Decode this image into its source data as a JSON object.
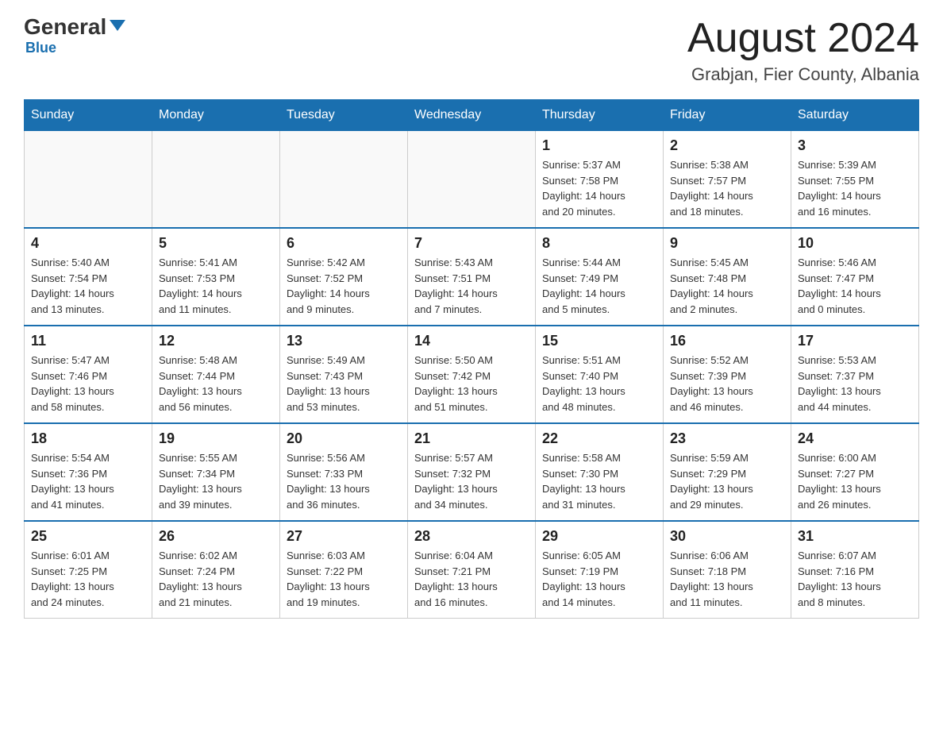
{
  "header": {
    "logo_general": "General",
    "logo_blue": "Blue",
    "main_title": "August 2024",
    "subtitle": "Grabjan, Fier County, Albania"
  },
  "days_of_week": [
    "Sunday",
    "Monday",
    "Tuesday",
    "Wednesday",
    "Thursday",
    "Friday",
    "Saturday"
  ],
  "weeks": [
    {
      "days": [
        {
          "num": "",
          "info": ""
        },
        {
          "num": "",
          "info": ""
        },
        {
          "num": "",
          "info": ""
        },
        {
          "num": "",
          "info": ""
        },
        {
          "num": "1",
          "info": "Sunrise: 5:37 AM\nSunset: 7:58 PM\nDaylight: 14 hours\nand 20 minutes."
        },
        {
          "num": "2",
          "info": "Sunrise: 5:38 AM\nSunset: 7:57 PM\nDaylight: 14 hours\nand 18 minutes."
        },
        {
          "num": "3",
          "info": "Sunrise: 5:39 AM\nSunset: 7:55 PM\nDaylight: 14 hours\nand 16 minutes."
        }
      ]
    },
    {
      "days": [
        {
          "num": "4",
          "info": "Sunrise: 5:40 AM\nSunset: 7:54 PM\nDaylight: 14 hours\nand 13 minutes."
        },
        {
          "num": "5",
          "info": "Sunrise: 5:41 AM\nSunset: 7:53 PM\nDaylight: 14 hours\nand 11 minutes."
        },
        {
          "num": "6",
          "info": "Sunrise: 5:42 AM\nSunset: 7:52 PM\nDaylight: 14 hours\nand 9 minutes."
        },
        {
          "num": "7",
          "info": "Sunrise: 5:43 AM\nSunset: 7:51 PM\nDaylight: 14 hours\nand 7 minutes."
        },
        {
          "num": "8",
          "info": "Sunrise: 5:44 AM\nSunset: 7:49 PM\nDaylight: 14 hours\nand 5 minutes."
        },
        {
          "num": "9",
          "info": "Sunrise: 5:45 AM\nSunset: 7:48 PM\nDaylight: 14 hours\nand 2 minutes."
        },
        {
          "num": "10",
          "info": "Sunrise: 5:46 AM\nSunset: 7:47 PM\nDaylight: 14 hours\nand 0 minutes."
        }
      ]
    },
    {
      "days": [
        {
          "num": "11",
          "info": "Sunrise: 5:47 AM\nSunset: 7:46 PM\nDaylight: 13 hours\nand 58 minutes."
        },
        {
          "num": "12",
          "info": "Sunrise: 5:48 AM\nSunset: 7:44 PM\nDaylight: 13 hours\nand 56 minutes."
        },
        {
          "num": "13",
          "info": "Sunrise: 5:49 AM\nSunset: 7:43 PM\nDaylight: 13 hours\nand 53 minutes."
        },
        {
          "num": "14",
          "info": "Sunrise: 5:50 AM\nSunset: 7:42 PM\nDaylight: 13 hours\nand 51 minutes."
        },
        {
          "num": "15",
          "info": "Sunrise: 5:51 AM\nSunset: 7:40 PM\nDaylight: 13 hours\nand 48 minutes."
        },
        {
          "num": "16",
          "info": "Sunrise: 5:52 AM\nSunset: 7:39 PM\nDaylight: 13 hours\nand 46 minutes."
        },
        {
          "num": "17",
          "info": "Sunrise: 5:53 AM\nSunset: 7:37 PM\nDaylight: 13 hours\nand 44 minutes."
        }
      ]
    },
    {
      "days": [
        {
          "num": "18",
          "info": "Sunrise: 5:54 AM\nSunset: 7:36 PM\nDaylight: 13 hours\nand 41 minutes."
        },
        {
          "num": "19",
          "info": "Sunrise: 5:55 AM\nSunset: 7:34 PM\nDaylight: 13 hours\nand 39 minutes."
        },
        {
          "num": "20",
          "info": "Sunrise: 5:56 AM\nSunset: 7:33 PM\nDaylight: 13 hours\nand 36 minutes."
        },
        {
          "num": "21",
          "info": "Sunrise: 5:57 AM\nSunset: 7:32 PM\nDaylight: 13 hours\nand 34 minutes."
        },
        {
          "num": "22",
          "info": "Sunrise: 5:58 AM\nSunset: 7:30 PM\nDaylight: 13 hours\nand 31 minutes."
        },
        {
          "num": "23",
          "info": "Sunrise: 5:59 AM\nSunset: 7:29 PM\nDaylight: 13 hours\nand 29 minutes."
        },
        {
          "num": "24",
          "info": "Sunrise: 6:00 AM\nSunset: 7:27 PM\nDaylight: 13 hours\nand 26 minutes."
        }
      ]
    },
    {
      "days": [
        {
          "num": "25",
          "info": "Sunrise: 6:01 AM\nSunset: 7:25 PM\nDaylight: 13 hours\nand 24 minutes."
        },
        {
          "num": "26",
          "info": "Sunrise: 6:02 AM\nSunset: 7:24 PM\nDaylight: 13 hours\nand 21 minutes."
        },
        {
          "num": "27",
          "info": "Sunrise: 6:03 AM\nSunset: 7:22 PM\nDaylight: 13 hours\nand 19 minutes."
        },
        {
          "num": "28",
          "info": "Sunrise: 6:04 AM\nSunset: 7:21 PM\nDaylight: 13 hours\nand 16 minutes."
        },
        {
          "num": "29",
          "info": "Sunrise: 6:05 AM\nSunset: 7:19 PM\nDaylight: 13 hours\nand 14 minutes."
        },
        {
          "num": "30",
          "info": "Sunrise: 6:06 AM\nSunset: 7:18 PM\nDaylight: 13 hours\nand 11 minutes."
        },
        {
          "num": "31",
          "info": "Sunrise: 6:07 AM\nSunset: 7:16 PM\nDaylight: 13 hours\nand 8 minutes."
        }
      ]
    }
  ]
}
